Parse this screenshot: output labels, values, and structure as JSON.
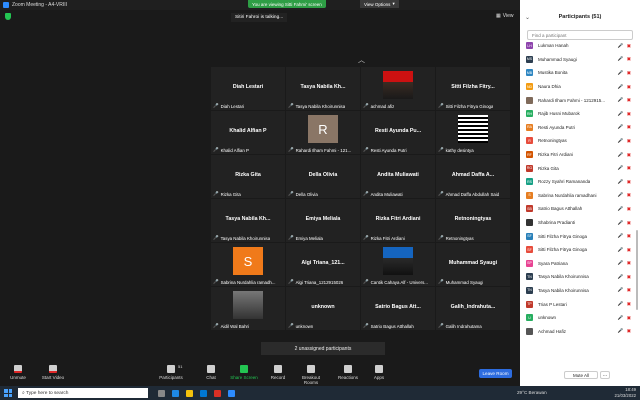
{
  "window": {
    "title": "Zoom Meeting - A4-VRIII",
    "sharing_banner": "You are viewing Sitti Fahmi' screen",
    "view_options": "View Options",
    "talking": "Sitiri Fahroi is talking...",
    "view": "View"
  },
  "tiles": [
    {
      "big": "Diah Lestari",
      "foot": "Diah Lestari",
      "pic": ""
    },
    {
      "big": "Tasya Nabila Kh...",
      "foot": "Tasya Nabila Khoirunnisa",
      "pic": ""
    },
    {
      "big": "",
      "foot": "achmad afiz",
      "pic": "photo"
    },
    {
      "big": "Sitti Filzha Fitry...",
      "foot": "Sitti Filzha Fitrya Ginoga",
      "pic": ""
    },
    {
      "big": "Khalid Alfian P",
      "foot": "Khalid Alfian P",
      "pic": ""
    },
    {
      "big": "",
      "foot": "Rahardi Ilham Fahmi - 121...",
      "pic": "avatar-r"
    },
    {
      "big": "Resti Ayunda Pu...",
      "foot": "Resti Ayunda Putri",
      "pic": ""
    },
    {
      "big": "",
      "foot": "kathy desintya",
      "pic": "stripes"
    },
    {
      "big": "Rizka Gita",
      "foot": "Rizka Gita",
      "pic": ""
    },
    {
      "big": "Della Olivia",
      "foot": "Della Olivia",
      "pic": ""
    },
    {
      "big": "Andita Muliawati",
      "foot": "Andita Muliawati",
      "pic": ""
    },
    {
      "big": "Ahmad Daffa A...",
      "foot": "Ahmad Daffa Abdullah Said",
      "pic": ""
    },
    {
      "big": "Tasya Nabila Kh...",
      "foot": "Tasya Nabila Khoirunnisa",
      "pic": ""
    },
    {
      "big": "Emiya Meliala",
      "foot": "Emiya Meliala",
      "pic": ""
    },
    {
      "big": "Rizka Fitri Ardiani",
      "foot": "Rizka Fitri Ardiani",
      "pic": ""
    },
    {
      "big": "Retnoningtyas",
      "foot": "Retnoningtyas",
      "pic": ""
    },
    {
      "big": "",
      "foot": "Sabrina Nurdahlia ramadh...",
      "pic": "avatar-s"
    },
    {
      "big": "Algi Triana_121...",
      "foot": "Algi Triana_1212915026",
      "pic": ""
    },
    {
      "big": "",
      "foot": "Cantik Cahaya Alf - Univers...",
      "pic": "photo2"
    },
    {
      "big": "Muhammad Syaugi",
      "foot": "Muhammad Syaugi",
      "pic": ""
    },
    {
      "big": "",
      "foot": "Aidil Wal Bahri",
      "pic": "gray"
    },
    {
      "big": "unknown",
      "foot": "unknown",
      "pic": ""
    },
    {
      "big": "Satrio Bagus Att...",
      "foot": "Satrio Bagus Atthallah",
      "pic": ""
    },
    {
      "big": "Galih_Indrahuta...",
      "foot": "Galih Indrahutama",
      "pic": ""
    }
  ],
  "unassigned": "2 unassigned participants",
  "toolbar": {
    "unmute": "Unmute",
    "start_video": "Start Video",
    "participants": "Participants",
    "participant_count": "51",
    "chat": "Chat",
    "share": "Share Screen",
    "record": "Record",
    "breakout": "Breakout Rooms",
    "reactions": "Reactions",
    "apps": "Apps",
    "leave": "Leave Room"
  },
  "panel": {
    "title": "Participants (51)",
    "find_placeholder": "Find a participant",
    "mute_all": "Mute All",
    "more": "...",
    "participants": [
      {
        "initials": "LH",
        "name": "Lukman Hanah",
        "color": "#8e44ad",
        "muted": true
      },
      {
        "initials": "MS",
        "name": "Muhammad Syaugi",
        "color": "#2c3e50",
        "muted": true
      },
      {
        "initials": "MB",
        "name": "Mustika Bonita",
        "color": "#2e86c1",
        "muted": true
      },
      {
        "initials": "ND",
        "name": "Naura Dhia",
        "color": "#f39c12",
        "muted": true
      },
      {
        "initials": "",
        "name": "Rahardi Ilham Fahmi - 1212915...",
        "color": "#7f6a5a",
        "muted": true
      },
      {
        "initials": "RH",
        "name": "Rajib Husni Mubarok",
        "color": "#27ae60",
        "muted": true
      },
      {
        "initials": "RA",
        "name": "Resti Ayunda Putri",
        "color": "#e67e22",
        "muted": true
      },
      {
        "initials": "R",
        "name": "Retnoningtyas",
        "color": "#e74c3c",
        "muted": true
      },
      {
        "initials": "RF",
        "name": "Rizka Fitri Ardiani",
        "color": "#d35400",
        "muted": true
      },
      {
        "initials": "RG",
        "name": "Rizka Gita",
        "color": "#c0392b",
        "muted": true
      },
      {
        "initials": "RS",
        "name": "Rozzy Syahri Ramananda",
        "color": "#16a085",
        "muted": true
      },
      {
        "initials": "S",
        "name": "Sabrina Nurdahlia ramadhani",
        "color": "#e67e22",
        "muted": true
      },
      {
        "initials": "SB",
        "name": "Satrio Bagus Atthallah",
        "color": "#c0392b",
        "muted": true
      },
      {
        "initials": "",
        "name": "Shabrina Pradianti",
        "color": "#333333",
        "muted": true
      },
      {
        "initials": "SF",
        "name": "Sitti Filzha Fitrya Ginoga",
        "color": "#2980b9",
        "muted": true
      },
      {
        "initials": "SF",
        "name": "Sitti Filzha Fitrya Ginoga",
        "color": "#e74c3c",
        "muted": true
      },
      {
        "initials": "SP",
        "name": "Syara Patriana",
        "color": "#e84393",
        "muted": true
      },
      {
        "initials": "TN",
        "name": "Tasya Nabila Khoirunnisa",
        "color": "#2c3e50",
        "muted": true
      },
      {
        "initials": "TN",
        "name": "Tasya Nabila Khoirunnisa",
        "color": "#2c3e50",
        "muted": true
      },
      {
        "initials": "TP",
        "name": "Trias P Lestari",
        "color": "#c0392b",
        "muted": true
      },
      {
        "initials": "U",
        "name": "unknown",
        "color": "#27ae60",
        "muted": true
      },
      {
        "initials": "",
        "name": "Achmad Hafiz",
        "color": "#555555",
        "muted": true
      }
    ]
  },
  "taskbar": {
    "search_placeholder": "Type here to search",
    "weather": "29°C Berawan",
    "time": "18:49",
    "date": "21/03/2022"
  }
}
